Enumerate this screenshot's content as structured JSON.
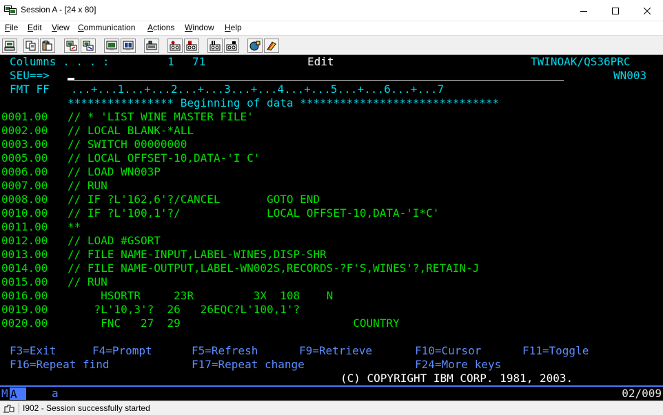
{
  "window": {
    "title": "Session A - [24 x 80]"
  },
  "menu": [
    {
      "key": "F",
      "rest": "ile"
    },
    {
      "key": "E",
      "rest": "dit"
    },
    {
      "key": "V",
      "rest": "iew"
    },
    {
      "key": "C",
      "rest": "ommunication"
    },
    {
      "key": "A",
      "rest": "ctions"
    },
    {
      "key": "W",
      "rest": "indow"
    },
    {
      "key": "H",
      "rest": "elp"
    }
  ],
  "screen": {
    "header": {
      "columns_label": "Columns . . . :",
      "col_from": "1",
      "col_to": "71",
      "mode": "Edit",
      "library": "TWINOAK/QS36PRC",
      "seu_prompt": "SEU==>",
      "member": "WN003",
      "fmt_label": "FMT FF",
      "ruler": " . . . + . . . 1 . . . + . . . 2 . . . + . . . 3 . . . + . . . 4 . . . + . . . 5 . . . + . . . 6 . . . + . . . 7"
    },
    "begin_marker": "**************** Beginning of data ******************************",
    "lines": [
      {
        "seq": "0001.00",
        "text": "// * 'LIST WINE MASTER FILE'"
      },
      {
        "seq": "0002.00",
        "text": "// LOCAL BLANK-*ALL"
      },
      {
        "seq": "0003.00",
        "text": "// SWITCH 00000000"
      },
      {
        "seq": "0005.00",
        "text": "// LOCAL OFFSET-10,DATA-'I C'"
      },
      {
        "seq": "0006.00",
        "text": "// LOAD WN003P"
      },
      {
        "seq": "0007.00",
        "text": "// RUN"
      },
      {
        "seq": "0008.00",
        "text": "// IF ?L'162,6'?/CANCEL       GOTO END"
      },
      {
        "seq": "0010.00",
        "text": "// IF ?L'100,1'?/             LOCAL OFFSET-10,DATA-'I*C'"
      },
      {
        "seq": "0011.00",
        "text": "**"
      },
      {
        "seq": "0012.00",
        "text": "// LOAD #GSORT"
      },
      {
        "seq": "0013.00",
        "text": "// FILE NAME-INPUT,LABEL-WINES,DISP-SHR"
      },
      {
        "seq": "0014.00",
        "text": "// FILE NAME-OUTPUT,LABEL-WN002S,RECORDS-?F'S,WINES'?,RETAIN-J"
      },
      {
        "seq": "0015.00",
        "text": "// RUN"
      },
      {
        "seq": "0016.00",
        "text": "     HSORTR     23R         3X  108    N"
      },
      {
        "seq": "0019.00",
        "text": "    ?L'10,3'?  26   26EQC?L'100,1'?"
      },
      {
        "seq": "0020.00",
        "text": "     FNC   27  29                          COUNTRY"
      }
    ],
    "fkeys_row1": [
      {
        "label": "F3=Exit"
      },
      {
        "label": "F4=Prompt"
      },
      {
        "label": "F5=Refresh"
      },
      {
        "label": "F9=Retrieve"
      },
      {
        "label": "F10=Cursor"
      },
      {
        "label": "F11=Toggle"
      }
    ],
    "fkeys_row2": [
      {
        "label": "F16=Repeat find"
      },
      {
        "label": "F17=Repeat change"
      },
      {
        "label": "F24=More keys"
      }
    ],
    "copyright": "(C) COPYRIGHT IBM CORP. 1981, 2003."
  },
  "oia": {
    "ma_m": "M",
    "ma_a": "A",
    "indicator": "a",
    "cursor_pos": "02/009"
  },
  "status": {
    "text": "I902 - Session successfully started"
  },
  "colors": {
    "terminal_bg": "#000000",
    "green": "#00e000",
    "cyan": "#00d7e8",
    "white": "#ffffff",
    "blue": "#4878ff"
  }
}
